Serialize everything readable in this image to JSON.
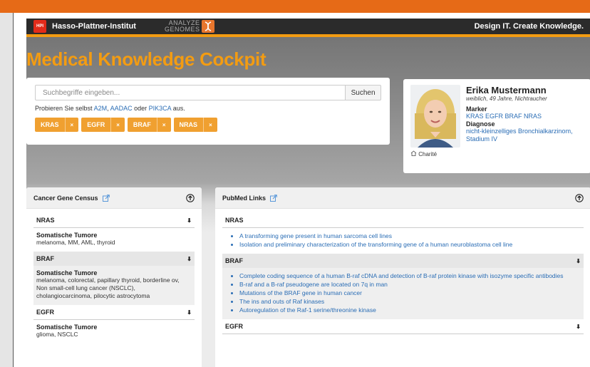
{
  "navbar": {
    "hpi_logo": "HPI",
    "hpi_name": "Hasso-Plattner-Institut",
    "analyze_line1": "ANALYZE",
    "analyze_line2": "GENOMES",
    "tagline": "Design IT. Create Knowledge."
  },
  "title": "Medical Knowledge Cockpit",
  "search": {
    "placeholder": "Suchbegriffe eingeben...",
    "button": "Suchen",
    "hint_prefix": "Probieren Sie selbst",
    "hint_links": [
      "A2M",
      "AADAC",
      "PIK3CA"
    ],
    "hint_sep": ",",
    "hint_or": "oder",
    "hint_suffix": "aus."
  },
  "chips": [
    {
      "label": "KRAS",
      "remove": "×"
    },
    {
      "label": "EGFR",
      "remove": "×"
    },
    {
      "label": "BRAF",
      "remove": "×"
    },
    {
      "label": "NRAS",
      "remove": "×"
    }
  ],
  "profile": {
    "name": "Erika Mustermann",
    "details": "weiblich, 49 Jahre, Nichtraucher",
    "marker_label": "Marker",
    "marker_value": "KRAS EGFR BRAF NRAS",
    "diagnosis_label": "Diagnose",
    "diagnosis_value": "nicht-kleinzelliges Bronchialkarzinom, Stadium IV",
    "institution": "Charité"
  },
  "cancer_census": {
    "title": "Cancer Gene Census",
    "genes": [
      {
        "name": "NRAS",
        "label": "Somatische Tumore",
        "text": "melanoma, MM, AML, thyroid"
      },
      {
        "name": "BRAF",
        "label": "Somatische Tumore",
        "text": "melanoma, colorectal, papillary thyroid, borderline ov, Non small-cell lung cancer (NSCLC), cholangiocarcinoma, pilocytic astrocytoma"
      },
      {
        "name": "EGFR",
        "label": "Somatische Tumore",
        "text": "glioma, NSCLC"
      }
    ]
  },
  "pubmed": {
    "title": "PubMed Links",
    "groups": [
      {
        "name": "NRAS",
        "links": [
          "A transforming gene present in human sarcoma cell lines",
          "Isolation and preliminary characterization of the transforming gene of a human neuroblastoma cell line"
        ]
      },
      {
        "name": "BRAF",
        "links": [
          "Complete coding sequence of a human B-raf cDNA and detection of B-raf protein kinase with isozyme specific antibodies",
          "B-raf and a B-raf pseudogene are located on 7q in man",
          "Mutations of the BRAF gene in human cancer",
          "The ins and outs of Raf kinases",
          "Autoregulation of the Raf-1 serine/threonine kinase"
        ]
      },
      {
        "name": "EGFR",
        "links": []
      }
    ]
  },
  "colors": {
    "accent": "#f39c12",
    "top_strip": "#e66a17",
    "navbar": "#2b2b2b",
    "link": "#2a6db5"
  }
}
